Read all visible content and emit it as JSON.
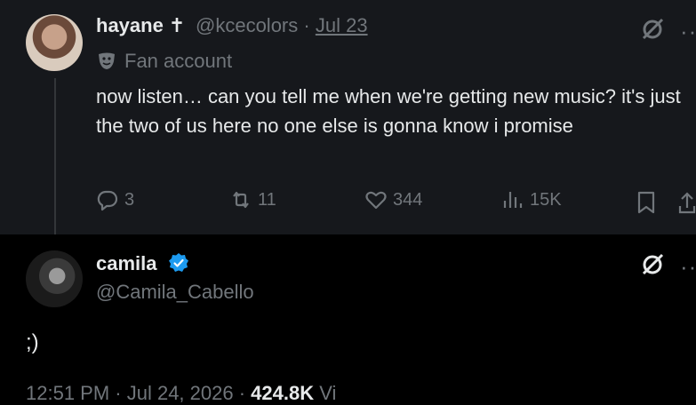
{
  "reply": {
    "display_name": "hayane ✝",
    "handle": "@kcecolors",
    "separator": "·",
    "date": "Jul 23",
    "label": "Fan account",
    "text": "now listen… can you tell me when we're getting new music? it's just the two of us here no one else is gonna know i promise",
    "replies": "3",
    "reposts": "11",
    "likes": "344",
    "views": "15K"
  },
  "main": {
    "display_name": "camila",
    "handle": "@Camila_Cabello",
    "text": ";)",
    "timestamp": "12:51 PM · Jul 24, 2026 · ",
    "views_count": "424.8K",
    "views_label": " Vi"
  },
  "icons": {
    "more": "··",
    "reply": "reply-icon",
    "repost": "repost-icon",
    "like": "heart-icon",
    "views": "analytics-icon",
    "bookmark": "bookmark-icon",
    "share": "share-icon",
    "grok": "grok-icon",
    "verified": "verified-badge-icon"
  },
  "colors": {
    "background": "#000000",
    "reply_card": "#16181c",
    "text": "#e7e9ea",
    "muted": "#71767b",
    "verified": "#1d9bf0"
  }
}
